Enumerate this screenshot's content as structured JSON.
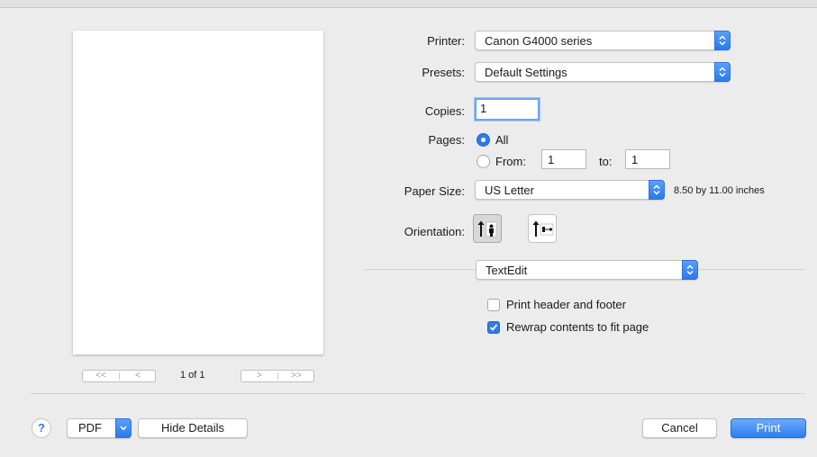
{
  "printer": {
    "label": "Printer:",
    "value": "Canon G4000 series"
  },
  "presets": {
    "label": "Presets:",
    "value": "Default Settings"
  },
  "copies": {
    "label": "Copies:",
    "value": "1"
  },
  "pages": {
    "label": "Pages:",
    "all_label": "All",
    "from_label": "From:",
    "from_value": "1",
    "to_label": "to:",
    "to_value": "1",
    "selected": "All"
  },
  "paper_size": {
    "label": "Paper Size:",
    "value": "US Letter",
    "dimensions": "8.50 by 11.00 inches"
  },
  "orientation": {
    "label": "Orientation:",
    "selected": "portrait",
    "options": [
      "portrait-icon",
      "landscape-icon"
    ]
  },
  "app_section": {
    "value": "TextEdit"
  },
  "options": [
    {
      "label": "Print header and footer",
      "checked": false
    },
    {
      "label": "Rewrap contents to fit page",
      "checked": true
    }
  ],
  "preview_nav": {
    "first": "<<",
    "prev": "<",
    "next": ">",
    "last": ">>",
    "page_indicator": "1 of 1"
  },
  "footer": {
    "help_label": "?",
    "pdf_label": "PDF",
    "hide_details_label": "Hide Details",
    "cancel_label": "Cancel",
    "print_label": "Print"
  },
  "colors": {
    "accent": "#2d7be9",
    "background": "#ececec"
  }
}
